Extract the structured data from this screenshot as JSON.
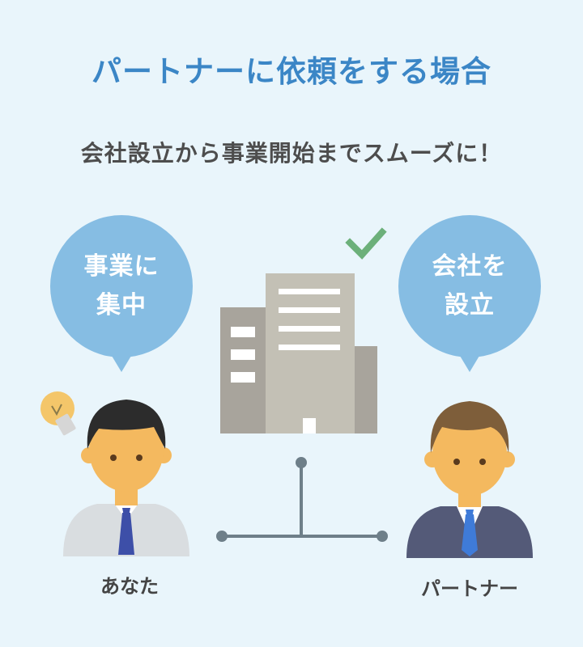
{
  "title": "パートナーに依頼をする場合",
  "subtitle": "会社設立から事業開始までスムーズに！",
  "bubbles": {
    "left": {
      "line1": "事業に",
      "line2": "集中"
    },
    "right": {
      "line1": "会社を",
      "line2": "設立"
    }
  },
  "people": {
    "you": {
      "label": "あなた",
      "icon": "lightbulb-icon"
    },
    "partner": {
      "label": "パートナー"
    }
  },
  "colors": {
    "background": "#e9f5fb",
    "title": "#3b86c6",
    "bubble": "#86bde3",
    "check": "#6cb07a",
    "building_main": "#c3c0b5",
    "building_side": "#a8a49c",
    "connector": "#6e7f89"
  }
}
